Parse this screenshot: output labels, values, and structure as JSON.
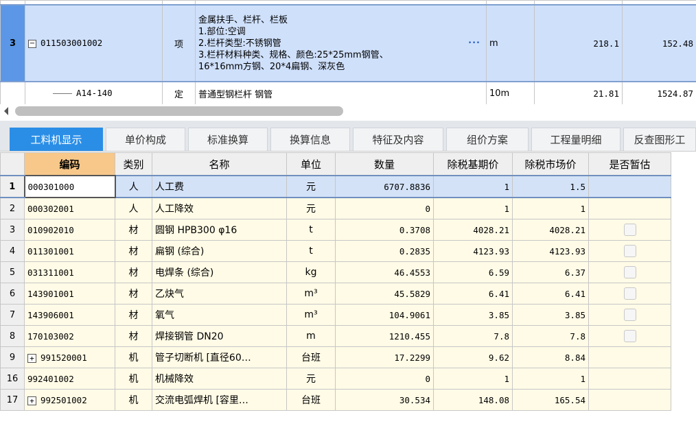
{
  "top_grid": {
    "selected_row": {
      "row_number": "3",
      "code": "011503001002",
      "type": "项",
      "name_lines": [
        "金属扶手、栏杆、栏板",
        "1.部位:空调",
        "2.栏杆类型:不锈钢管",
        "3.栏杆材料种类、规格、颜色:25*25mm钢管、",
        "16*16mm方钢、20*4扁钢、深灰色"
      ],
      "more_label": "···",
      "unit": "m",
      "quantity": "218.1",
      "price": "152.48"
    },
    "child_row": {
      "code": "A14-140",
      "type": "定",
      "name": "普通型钢栏杆 钢管",
      "unit": "10m",
      "quantity": "21.81",
      "price": "1524.87"
    }
  },
  "tabs": [
    "工料机显示",
    "单价构成",
    "标准换算",
    "换算信息",
    "特征及内容",
    "组价方案",
    "工程量明细",
    "反查图形工"
  ],
  "active_tab_index": 0,
  "resource_table": {
    "headers": [
      "编码",
      "类别",
      "名称",
      "单位",
      "数量",
      "除税基期价",
      "除税市场价",
      "是否暂估"
    ],
    "rows": [
      {
        "rn": "1",
        "code": "000301000",
        "cat": "人",
        "name": "人工费",
        "unit": "元",
        "qty": "6707.8836",
        "base": "1",
        "market": "1.5",
        "check": false,
        "expand": false
      },
      {
        "rn": "2",
        "code": "000302001",
        "cat": "人",
        "name": "人工降效",
        "unit": "元",
        "qty": "0",
        "base": "1",
        "market": "1",
        "check": false,
        "expand": false
      },
      {
        "rn": "3",
        "code": "010902010",
        "cat": "材",
        "name": "圆钢 HPB300 φ16",
        "unit": "t",
        "qty": "0.3708",
        "base": "4028.21",
        "market": "4028.21",
        "check": true,
        "expand": false
      },
      {
        "rn": "4",
        "code": "011301001",
        "cat": "材",
        "name": "扁钢 (综合)",
        "unit": "t",
        "qty": "0.2835",
        "base": "4123.93",
        "market": "4123.93",
        "check": true,
        "expand": false
      },
      {
        "rn": "5",
        "code": "031311001",
        "cat": "材",
        "name": "电焊条 (综合)",
        "unit": "kg",
        "qty": "46.4553",
        "base": "6.59",
        "market": "6.37",
        "check": true,
        "expand": false
      },
      {
        "rn": "6",
        "code": "143901001",
        "cat": "材",
        "name": "乙炔气",
        "unit": "m³",
        "qty": "45.5829",
        "base": "6.41",
        "market": "6.41",
        "check": true,
        "expand": false
      },
      {
        "rn": "7",
        "code": "143906001",
        "cat": "材",
        "name": "氧气",
        "unit": "m³",
        "qty": "104.9061",
        "base": "3.85",
        "market": "3.85",
        "check": true,
        "expand": false
      },
      {
        "rn": "8",
        "code": "170103002",
        "cat": "材",
        "name": "焊接钢管 DN20",
        "unit": "m",
        "qty": "1210.455",
        "base": "7.8",
        "market": "7.8",
        "check": true,
        "expand": false
      },
      {
        "rn": "9",
        "code": "991520001",
        "cat": "机",
        "name": "管子切断机 [直径60…",
        "unit": "台班",
        "qty": "17.2299",
        "base": "9.62",
        "market": "8.84",
        "check": false,
        "expand": true
      },
      {
        "rn": "16",
        "code": "992401002",
        "cat": "机",
        "name": "机械降效",
        "unit": "元",
        "qty": "0",
        "base": "1",
        "market": "1",
        "check": false,
        "expand": false
      },
      {
        "rn": "17",
        "code": "992501002",
        "cat": "机",
        "name": "交流电弧焊机 [容里…",
        "unit": "台班",
        "qty": "30.534",
        "base": "148.08",
        "market": "165.54",
        "check": false,
        "expand": true
      }
    ]
  }
}
